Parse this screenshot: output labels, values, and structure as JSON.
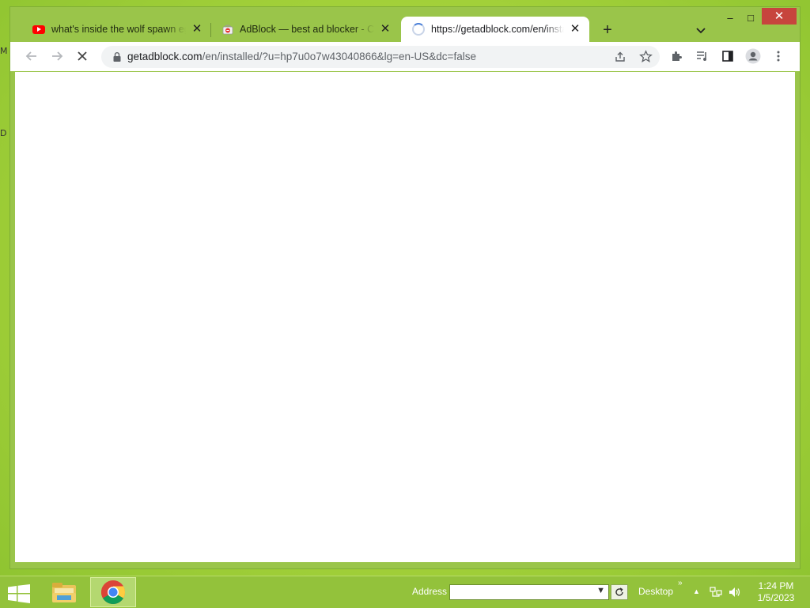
{
  "desktop": {
    "edge_labels": [
      "M",
      "D"
    ]
  },
  "browser": {
    "tabs": [
      {
        "label": "what's inside the wolf spawn egg",
        "close": "✕"
      },
      {
        "label": "AdBlock — best ad blocker - Chrome Web Store",
        "close": "✕"
      },
      {
        "label": "https://getadblock.com/en/installed/",
        "close": "✕"
      }
    ],
    "new_tab": "+",
    "window_controls": {
      "minimize": "–",
      "maximize": "□",
      "close": "✕"
    },
    "address": {
      "host": "getadblock.com",
      "path": "/en/installed/?u=hp7u0o7w43040866&lg=en-US&dc=false"
    }
  },
  "taskbar": {
    "address_label": "Address",
    "address_value": "",
    "desktop_label": "Desktop",
    "toolbar_chevron": "»",
    "clock": {
      "time": "1:24 PM",
      "date": "1/5/2023"
    }
  },
  "colors": {
    "desktop_green": "#a9d43c",
    "chrome_frame": "#9ac54a",
    "close_red": "#c7453d",
    "youtube_red": "#ff0000"
  }
}
